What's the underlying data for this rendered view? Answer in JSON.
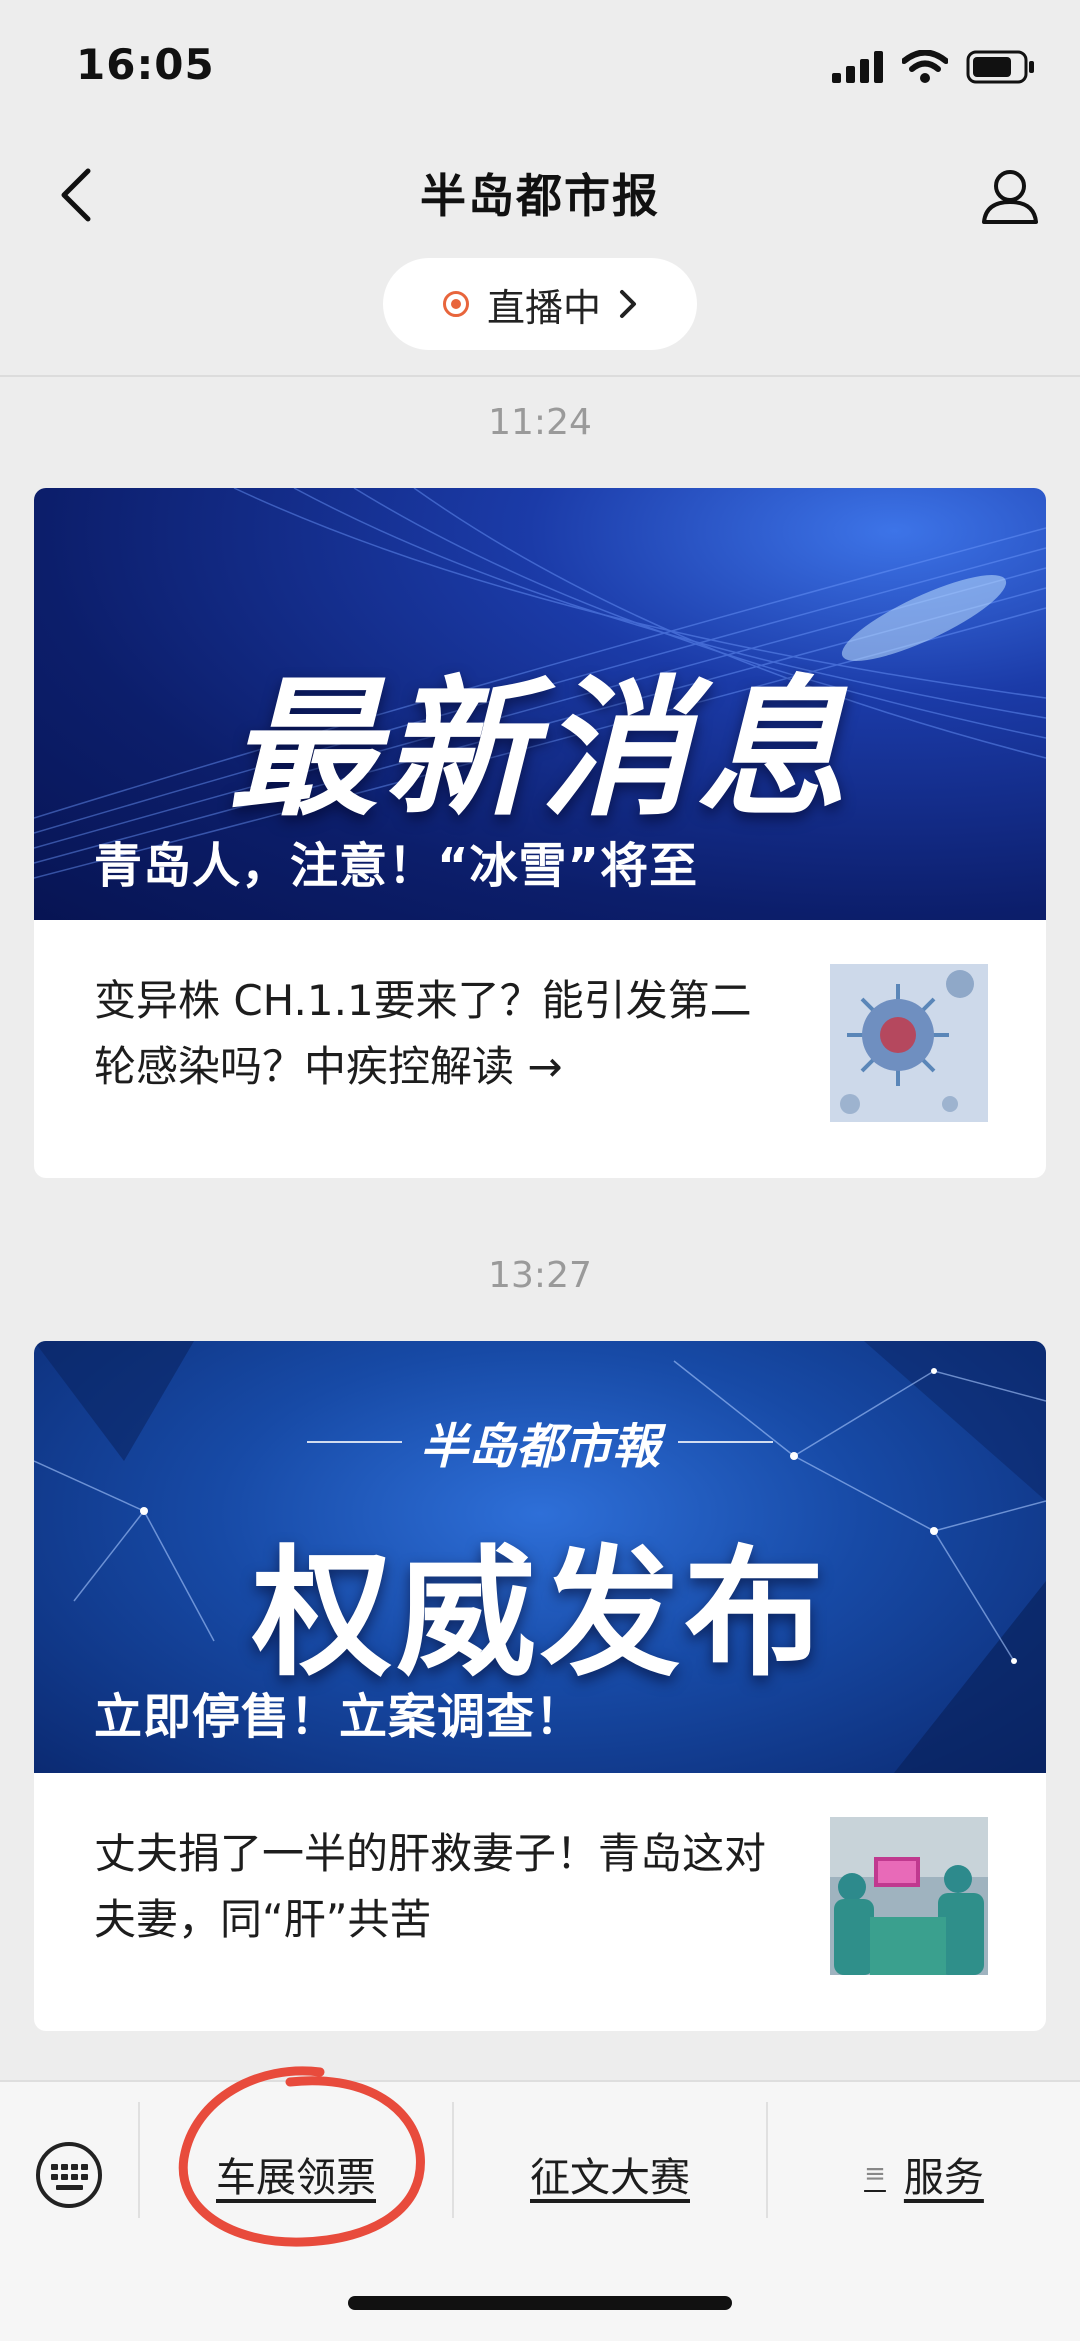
{
  "status_bar": {
    "time": "16:05"
  },
  "nav": {
    "title": "半岛都市报",
    "live_label": "直播中"
  },
  "messages": [
    {
      "time": "11:24",
      "banner_headline": "最新消息",
      "banner_subtitle": "青岛人，注意！“冰雪”将至",
      "text": "变异株 CH.1.1要来了？能引发第二轮感染吗？中疾控解读 →"
    },
    {
      "time": "13:27",
      "banner_brand": "半岛都市報",
      "banner_headline": "权威发布",
      "banner_subtitle": "立即停售！立案调查！",
      "text": "丈夫捐了一半的肝救妻子！青岛这对夫妻，同“肝”共苦"
    }
  ],
  "bottom_menu": [
    {
      "label": "车展领票"
    },
    {
      "label": "征文大赛"
    },
    {
      "label": "服务",
      "icon": "menu-list-icon"
    }
  ],
  "colors": {
    "live_dot": "#e8653c",
    "annotation_circle": "#e84b3c"
  }
}
